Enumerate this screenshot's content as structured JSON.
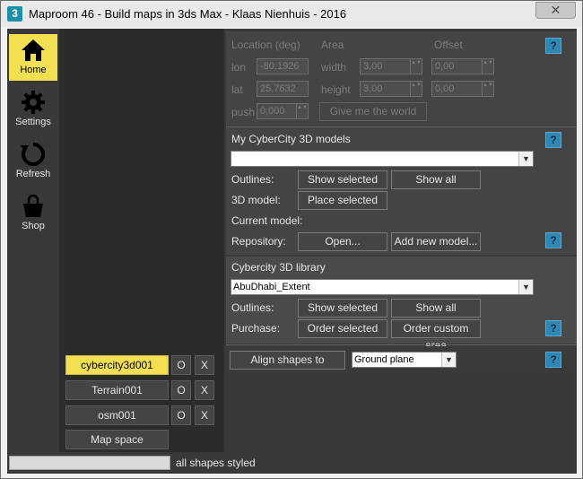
{
  "window": {
    "icon_text": "3",
    "title": "Maproom 46 - Build maps in 3ds Max - Klaas Nienhuis - 2016",
    "close_label": "✕"
  },
  "nav": {
    "home": "Home",
    "settings": "Settings",
    "refresh": "Refresh",
    "shop": "Shop"
  },
  "objects": [
    {
      "name": "cybercity3d001",
      "o": "O",
      "x": "X"
    },
    {
      "name": "Terrain001",
      "o": "O",
      "x": "X"
    },
    {
      "name": "osm001",
      "o": "O",
      "x": "X"
    }
  ],
  "map_space_label": "Map space",
  "status": {
    "progress": 1.0,
    "text": "all shapes styled"
  },
  "location": {
    "header_location": "Location (deg)",
    "header_area": "Area",
    "header_offset": "Offset",
    "lon_label": "lon",
    "lon_value": "-80.1926",
    "lat_label": "lat",
    "lat_value": "25.7632",
    "width_label": "width",
    "width_value": "3,00",
    "height_label": "height",
    "height_value": "3,00",
    "offset_x": "0,00",
    "offset_y": "0,00",
    "push_label": "push",
    "push_value": "0,000",
    "give_world_label": "Give me the world",
    "help": "?"
  },
  "models": {
    "header": "My CyberCity 3D models",
    "combo_value": "",
    "outlines_label": "Outlines:",
    "show_selected": "Show selected",
    "show_all": "Show all",
    "model_label": "3D model:",
    "place_selected": "Place selected",
    "current_model_label": "Current model:",
    "repository_label": "Repository:",
    "open_label": "Open...",
    "add_new_label": "Add new model...",
    "help": "?",
    "help2": "?"
  },
  "library": {
    "header": "Cybercity 3D library",
    "combo_value": "AbuDhabi_Extent",
    "outlines_label": "Outlines:",
    "show_selected": "Show selected",
    "show_all": "Show all",
    "purchase_label": "Purchase:",
    "order_selected": "Order selected",
    "order_custom": "Order custom area",
    "help": "?"
  },
  "align": {
    "button_label": "Align shapes to",
    "combo_value": "Ground plane",
    "help": "?"
  },
  "icons": {
    "spin_arrows": "▲▼",
    "dropdown": "▼"
  }
}
